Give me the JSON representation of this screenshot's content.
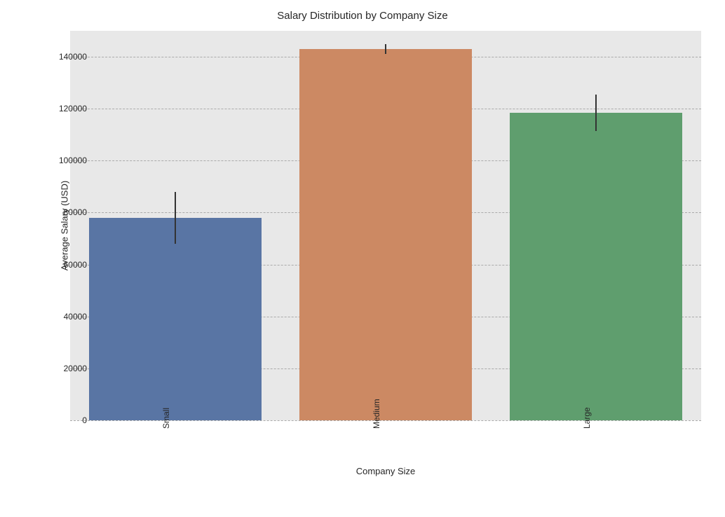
{
  "chart_data": {
    "type": "bar",
    "title": "Salary Distribution by Company Size",
    "xlabel": "Company Size",
    "ylabel": "Average Salary (USD)",
    "ylim": [
      0,
      150000
    ],
    "yticks": [
      0,
      20000,
      40000,
      60000,
      80000,
      100000,
      120000,
      140000
    ],
    "categories": [
      "Small",
      "Medium",
      "Large"
    ],
    "values": [
      78000,
      143000,
      118500
    ],
    "error_low": [
      68000,
      141000,
      111500
    ],
    "error_high": [
      88000,
      145000,
      125500
    ],
    "colors": [
      "#5975a4",
      "#cc8963",
      "#5f9e6e"
    ]
  }
}
